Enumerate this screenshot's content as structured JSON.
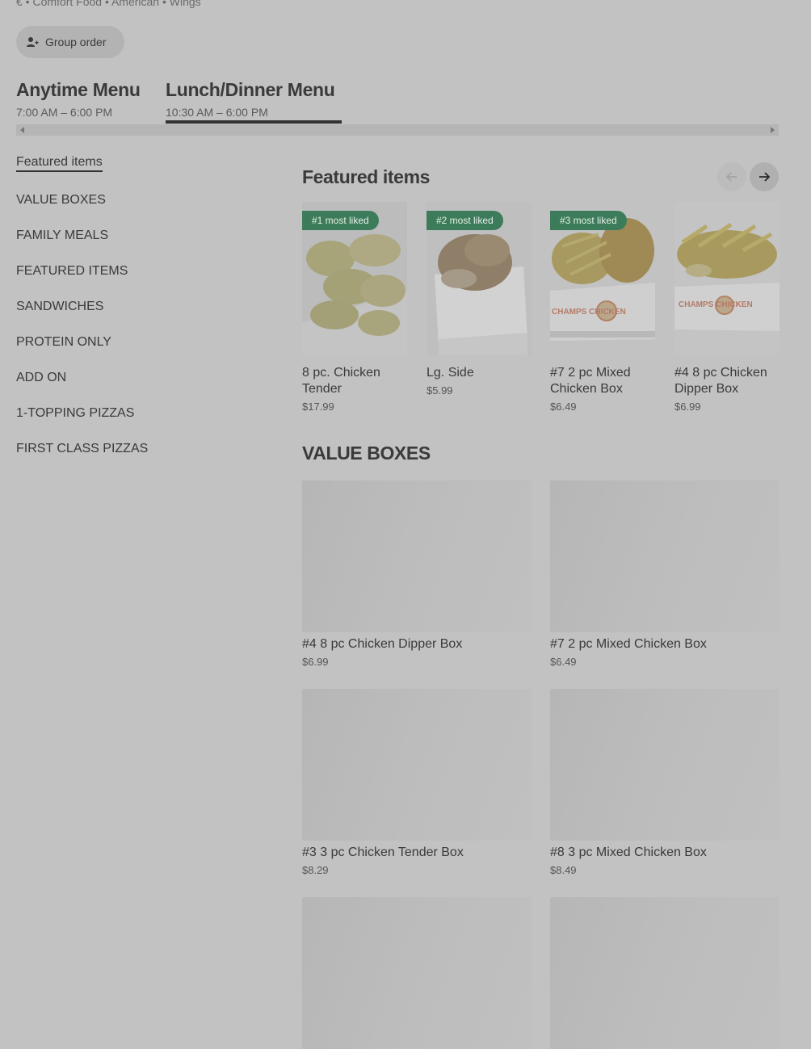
{
  "store": {
    "info_line": "€ • Comfort Food • American • Wings"
  },
  "group_order": {
    "label": "Group order"
  },
  "menus": [
    {
      "title": "Anytime Menu",
      "hours": "7:00 AM – 6:00 PM"
    },
    {
      "title": "Lunch/Dinner Menu",
      "hours": "10:30 AM – 6:00 PM"
    }
  ],
  "sidebar": {
    "items": [
      {
        "label": "Featured items"
      },
      {
        "label": "VALUE BOXES"
      },
      {
        "label": "FAMILY MEALS"
      },
      {
        "label": "FEATURED ITEMS"
      },
      {
        "label": "SANDWICHES"
      },
      {
        "label": "PROTEIN ONLY"
      },
      {
        "label": "ADD ON"
      },
      {
        "label": "1-TOPPING PIZZAS"
      },
      {
        "label": "FIRST CLASS PIZZAS"
      }
    ]
  },
  "featured": {
    "title": "Featured items",
    "items": [
      {
        "badge": "#1 most liked",
        "name": "8 pc. Chicken Tender",
        "price": "$17.99"
      },
      {
        "badge": "#2 most liked",
        "name": "Lg. Side",
        "price": "$5.99"
      },
      {
        "badge": "#3 most liked",
        "name": "#7 2 pc Mixed Chicken Box",
        "price": "$6.49"
      },
      {
        "badge": "",
        "name": "#4 8 pc Chicken Dipper Box",
        "price": "$6.99"
      }
    ]
  },
  "value_boxes": {
    "title": "VALUE BOXES",
    "items": [
      {
        "name": "#4 8 pc Chicken Dipper Box",
        "price": "$6.99"
      },
      {
        "name": "#7 2 pc Mixed Chicken Box",
        "price": "$6.49"
      },
      {
        "name": "#3 3 pc Chicken Tender Box",
        "price": "$8.29"
      },
      {
        "name": "#8 3 pc Mixed Chicken Box",
        "price": "$8.49"
      }
    ]
  },
  "food_photo_text": {
    "brand": "CHAMPS CHICKEN"
  },
  "colors": {
    "badge": "#3d7c5a",
    "overlay_bg": "#c2c2c2"
  }
}
